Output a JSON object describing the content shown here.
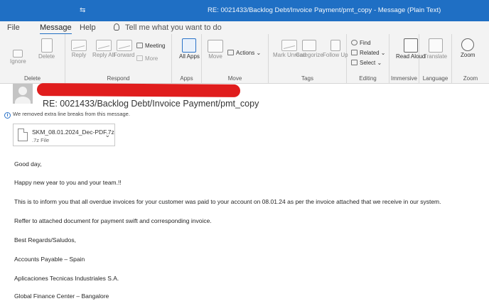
{
  "window": {
    "qat_glyph": "⇆",
    "title": "RE: 0021433/Backlog Debt/Invoice Payment/pmt_copy  -  Message (Plain Text)"
  },
  "menu": {
    "tabs": [
      "File",
      "Message",
      "Help"
    ],
    "active_tab": "Message",
    "tell_me": "Tell me what you want to do"
  },
  "ribbon": {
    "groups": {
      "delete": "Delete",
      "respond": "Respond",
      "apps": "Apps",
      "move": "Move",
      "tags": "Tags",
      "editing": "Editing",
      "immersive": "Immersive",
      "language": "Language",
      "zoom": "Zoom"
    },
    "buttons": {
      "ignore": "Ignore",
      "delete": "Delete",
      "reply": "Reply",
      "reply_all": "Reply All",
      "forward": "Forward",
      "meeting": "Meeting",
      "more": "More",
      "all_apps": "All Apps",
      "move": "Move",
      "actions": "Actions",
      "mark_unread": "Mark Unread",
      "categorize": "Categorize",
      "follow_up": "Follow Up",
      "find": "Find",
      "related": "Related",
      "select": "Select",
      "read_aloud": "Read Aloud",
      "translate": "Translate",
      "zoom": "Zoom"
    }
  },
  "message": {
    "subject": "RE: 0021433/Backlog Debt/Invoice Payment/pmt_copy",
    "info": "We removed extra line breaks from this message.",
    "attachment": {
      "name": "SKM_08.01.2024_Dec-PDF.7z",
      "type": ".7z File"
    },
    "body": [
      "Good day,",
      "Happy new year to you and your team.!!",
      "This is to inform you that all overdue invoices for your customer was paid to your account on 08.01.24 as per the invoice attached that we receive in our system.",
      "Reffer to attached document for payment swift and corresponding invoice.",
      "Best Regards/Saludos,",
      "Accounts Payable – Spain",
      "Aplicaciones Tecnicas Industriales S.A.",
      "Global Finance Center – Bangalore"
    ]
  },
  "colors": {
    "titlebar": "#1f6fc4",
    "ribbon": "#f3f3f3",
    "redaction": "#e01d1d"
  }
}
